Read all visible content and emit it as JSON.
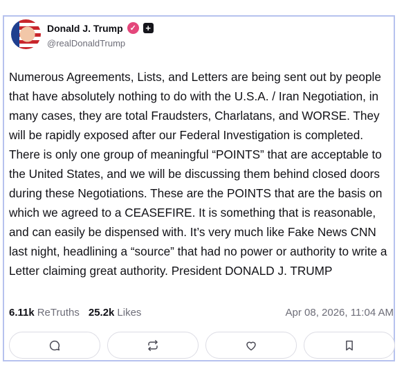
{
  "post": {
    "author_name": "Donald J. Trump",
    "handle": "@realDonaldTrump",
    "verified_icon": "check-badge-icon",
    "plus_icon": "plus-icon",
    "text": "Numerous Agreements, Lists, and Letters are being sent out by people that have absolutely nothing to do with the U.S.A. / Iran Negotiation, in many cases, they are total Fraudsters, Charlatans, and WORSE. They will be rapidly exposed after our Federal Investigation is completed. There is only one group of meaningful “POINTS” that are acceptable to the United States, and we will be discussing them behind closed doors during these Negotiations. These are the POINTS that are the basis on which we agreed to a CEASEFIRE. It is something that is reasonable, and can easily be dispensed with. It’s very much like Fake News CNN last night, headlining a “source” that had no power or authority to write a Letter claiming great authority. President DONALD J. TRUMP",
    "retruths_count": "6.11k",
    "retruths_label": "ReTruths",
    "likes_count": "25.2k",
    "likes_label": "Likes",
    "timestamp": "Apr 08, 2026, 11:04 AM"
  },
  "actions": [
    "reply-icon",
    "retruth-icon",
    "like-icon",
    "bookmark-icon"
  ],
  "colors": {
    "card_border": "#b6c2ee",
    "verified_badge": "#e4477b",
    "muted_text": "#6d6d78"
  }
}
